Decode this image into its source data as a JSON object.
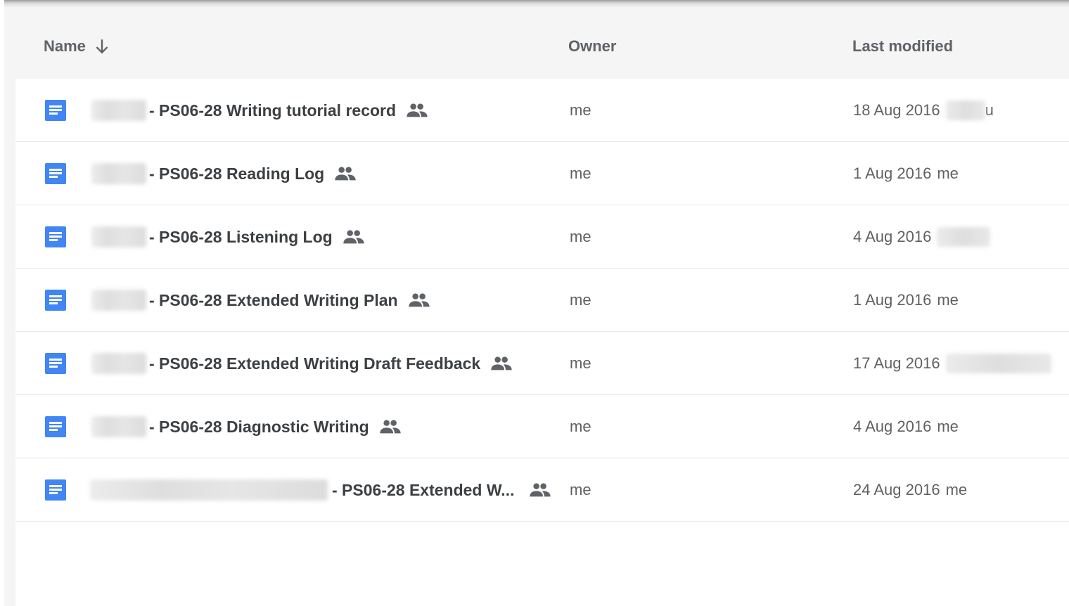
{
  "header": {
    "name_label": "Name",
    "owner_label": "Owner",
    "modified_label": "Last modified"
  },
  "icons": {
    "sort": "arrow-down-icon",
    "document": "google-docs-icon",
    "shared": "people-icon"
  },
  "colors": {
    "doc_icon": "#4285f4",
    "header_text": "#5f6368",
    "name_text": "#3c4043",
    "meta_text": "#616161"
  },
  "files": [
    {
      "name": "- PS06-28 Writing tutorial record",
      "owner": "me",
      "modified_date": "18 Aug 2016",
      "modified_by": "u"
    },
    {
      "name": "- PS06-28 Reading Log",
      "owner": "me",
      "modified_date": "1 Aug 2016",
      "modified_by": "me"
    },
    {
      "name": "- PS06-28 Listening Log",
      "owner": "me",
      "modified_date": "4 Aug 2016",
      "modified_by": ""
    },
    {
      "name": "- PS06-28 Extended Writing Plan",
      "owner": "me",
      "modified_date": "1 Aug 2016",
      "modified_by": "me"
    },
    {
      "name": "- PS06-28 Extended Writing Draft Feedback",
      "owner": "me",
      "modified_date": "17 Aug 2016",
      "modified_by": ""
    },
    {
      "name": "- PS06-28 Diagnostic Writing",
      "owner": "me",
      "modified_date": "4 Aug 2016",
      "modified_by": "me"
    },
    {
      "name": "- PS06-28 Extended W...",
      "owner": "me",
      "modified_date": "24 Aug 2016",
      "modified_by": "me"
    }
  ]
}
